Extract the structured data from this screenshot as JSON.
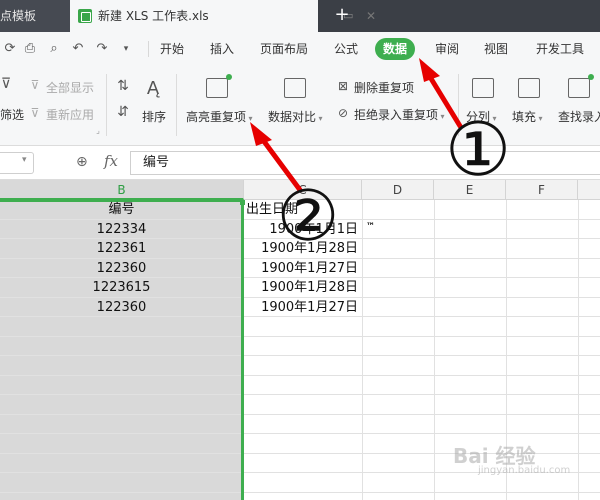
{
  "titlebar": {
    "tabs": [
      {
        "label": "点模板"
      },
      {
        "label": "新建 XLS 工作表.xls"
      }
    ],
    "new_tab": "+"
  },
  "menubar": {
    "items": [
      {
        "label": "开始"
      },
      {
        "label": "插入"
      },
      {
        "label": "页面布局"
      },
      {
        "label": "公式"
      },
      {
        "label": "数据"
      },
      {
        "label": "审阅"
      },
      {
        "label": "视图"
      },
      {
        "label": "开发工具"
      }
    ],
    "active_color": "#3eae4f"
  },
  "ribbon": {
    "show_all": "全部显示",
    "filter": "筛选",
    "reapply": "重新应用",
    "sort": "排序",
    "highlight_duplicates": "高亮重复项",
    "compare_data": "数据对比",
    "remove_duplicates": "删除重复项",
    "reject_duplicates": "拒绝录入重复项",
    "split_column": "分列",
    "fill": "填充",
    "find_record": "查找录入"
  },
  "formula_bar": {
    "fx": "fx",
    "content": "编号"
  },
  "sheet": {
    "columns": [
      "B",
      "C",
      "D",
      "E",
      "F"
    ],
    "rows": [
      {
        "b": "编号",
        "c": "出生日期"
      },
      {
        "b": "122334",
        "c": "1900年1月1日"
      },
      {
        "b": "122361",
        "c": "1900年1月28日"
      },
      {
        "b": "122360",
        "c": "1900年1月27日"
      },
      {
        "b": "1223615",
        "c": "1900年1月28日"
      },
      {
        "b": "122360",
        "c": "1900年1月27日"
      }
    ],
    "tm_mark": "™"
  },
  "annotations": {
    "one": "①",
    "two": "②"
  },
  "watermark": {
    "text": "Bai 经验",
    "sub": "jingyan.baidu.com"
  }
}
